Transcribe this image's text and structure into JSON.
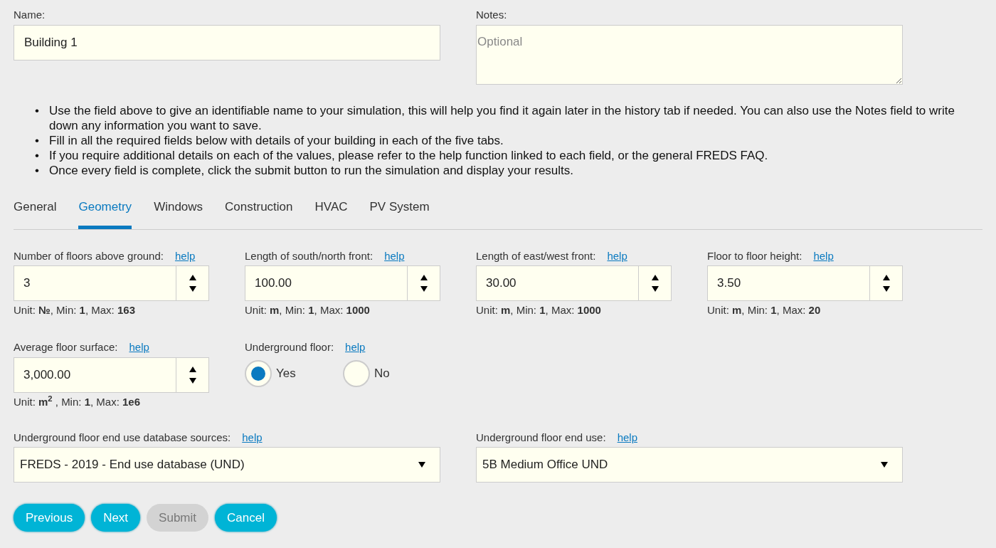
{
  "name_field": {
    "label": "Name:",
    "value": "Building 1"
  },
  "notes_field": {
    "label": "Notes:",
    "placeholder": "Optional"
  },
  "instructions": [
    {
      "bullet": "•",
      "text": "Use the field above to give an identifiable name to your simulation, this will help you find it again later in the history tab if needed. You can also use the Notes field to write down any information you want to save."
    },
    {
      "bullet": "•",
      "text": "Fill in all the required fields below with details of your building in each of the five tabs."
    },
    {
      "bullet": "•",
      "text": "If you require additional details on each of the values, please refer to the help function linked to each field, or the general FREDS FAQ."
    },
    {
      "bullet": "•",
      "text": "Once every field is complete, click the submit button to run the simulation and display your results."
    }
  ],
  "tabs": [
    {
      "label": "General",
      "selected": false
    },
    {
      "label": "Geometry",
      "selected": true
    },
    {
      "label": "Windows",
      "selected": false
    },
    {
      "label": "Construction",
      "selected": false
    },
    {
      "label": "HVAC",
      "selected": false
    },
    {
      "label": "PV System",
      "selected": false
    }
  ],
  "number_fields": [
    {
      "label": "Number of floors above ground:",
      "help": "help",
      "value": "3",
      "unit": "Unit: **№**, Min: **1**, Max: **163**"
    },
    {
      "label": "Length of south/north front:",
      "help": "help",
      "value": "100.00",
      "unit": "Unit: **m**, Min: **1**, Max: **1000**"
    },
    {
      "label": "Length of east/west front:",
      "help": "help",
      "value": "30.00",
      "unit": "Unit: **m**, Min: **1**, Max: **1000**"
    },
    {
      "label": "Floor to floor height:",
      "help": "help",
      "value": "3.50",
      "unit": "Unit: **m**, Min: **1**, Max: **20**"
    },
    {
      "label": "Average floor surface:",
      "help": "help",
      "value": "3,000.00",
      "unit": "Unit: **m$^{2}$** , Min: **1**, Max: **1e6**"
    }
  ],
  "underground_floor": {
    "label": "Underground floor:",
    "help": "help",
    "options": [
      {
        "label": "Yes",
        "selected": true
      },
      {
        "label": "No",
        "selected": false
      }
    ]
  },
  "selects": [
    {
      "label": "Underground floor end use database sources:",
      "help": "help",
      "value": "FREDS - 2019 - End use database (UND)"
    },
    {
      "label": "Underground floor end use:",
      "help": "help",
      "value": "5B Medium Office UND"
    }
  ],
  "buttons": [
    {
      "label": "Previous",
      "disabled": false
    },
    {
      "label": "Next",
      "disabled": false
    },
    {
      "label": "Submit",
      "disabled": true
    },
    {
      "label": "Cancel",
      "disabled": false
    }
  ]
}
